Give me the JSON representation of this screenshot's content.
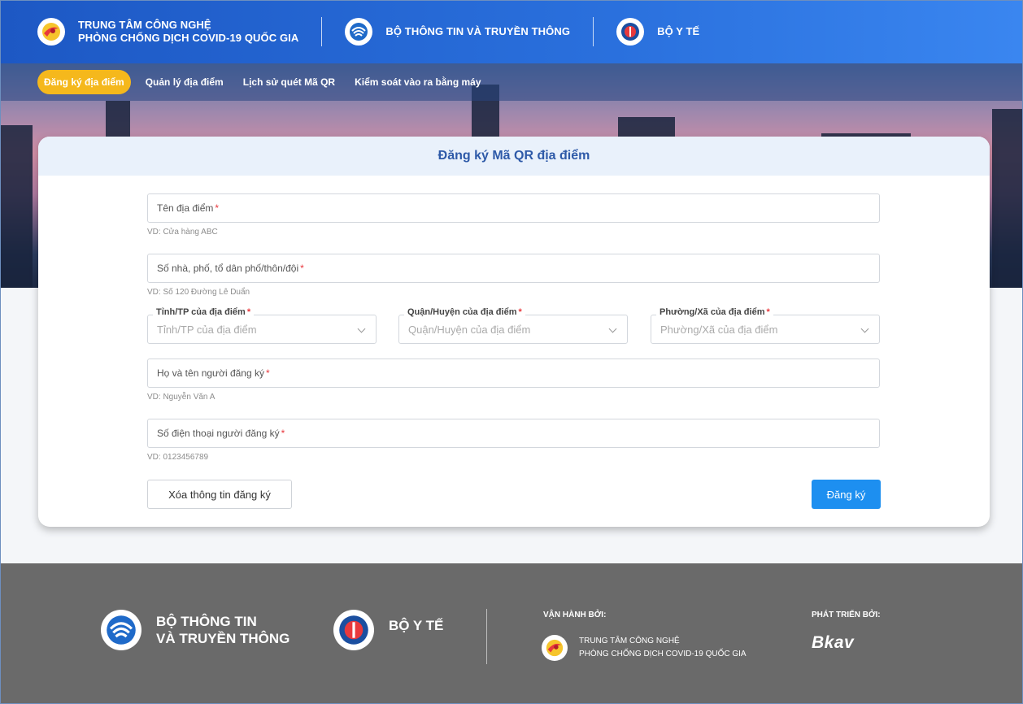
{
  "header": {
    "center_name": "TRUNG TÂM CÔNG NGHỆ\nPHÒNG CHỐNG DỊCH COVID-19 QUỐC GIA",
    "center_line1": "TRUNG TÂM CÔNG NGHỆ",
    "center_line2": "PHÒNG CHỐNG DỊCH COVID-19 QUỐC GIA",
    "ministry_ict": "BỘ THÔNG TIN VÀ TRUYỀN THÔNG",
    "ministry_health": "BỘ Y TẾ"
  },
  "nav": {
    "items": [
      {
        "label": "Đăng ký địa điểm",
        "active": true
      },
      {
        "label": "Quản lý địa điểm",
        "active": false
      },
      {
        "label": "Lịch sử quét Mã QR",
        "active": false
      },
      {
        "label": "Kiểm soát vào ra bằng máy",
        "active": false
      }
    ]
  },
  "form": {
    "title": "Đăng ký Mã QR địa điểm",
    "required_mark": "*",
    "place_name": {
      "placeholder": "Tên địa điểm",
      "hint": "VD: Cửa hàng ABC"
    },
    "address": {
      "placeholder": "Số nhà, phố, tổ dân phố/thôn/đội",
      "hint": "VD: Số 120 Đường Lê Duẩn"
    },
    "province": {
      "label": "Tỉnh/TP của địa điểm",
      "placeholder": "Tỉnh/TP của địa điểm"
    },
    "district": {
      "label": "Quận/Huyện của địa điểm",
      "placeholder": "Quận/Huyện của địa điểm"
    },
    "ward": {
      "label": "Phường/Xã của địa điểm",
      "placeholder": "Phường/Xã của địa điểm"
    },
    "registrant_name": {
      "placeholder": "Họ và tên người đăng ký",
      "hint": "VD: Nguyễn Văn A"
    },
    "registrant_phone": {
      "placeholder": "Số điện thoại người đăng ký",
      "hint": "VD: 0123456789"
    },
    "clear_label": "Xóa thông tin đăng ký",
    "submit_label": "Đăng ký"
  },
  "footer": {
    "ict_line1": "BỘ THÔNG TIN",
    "ict_line2": "VÀ TRUYỀN THÔNG",
    "health": "BỘ Y TẾ",
    "operated_by": "VẬN HÀNH BỞI:",
    "operator_line1": "TRUNG TÂM CÔNG NGHỆ",
    "operator_line2": "PHÒNG CHỐNG DỊCH COVID-19 QUỐC GIA",
    "developed_by": "PHÁT TRIỂN BỞI:",
    "developer": "Bkav"
  },
  "colors": {
    "header_blue": "#2a70dd",
    "nav_active": "#f5b81c",
    "title_blue": "#2e5aa8",
    "submit_blue": "#1d8ff0",
    "required_red": "#e8383d",
    "footer_gray": "#6a6a6a"
  },
  "icons": [
    "covid-center-logo-icon",
    "ministry-ict-logo-icon",
    "ministry-health-logo-icon",
    "chevron-down-icon"
  ]
}
